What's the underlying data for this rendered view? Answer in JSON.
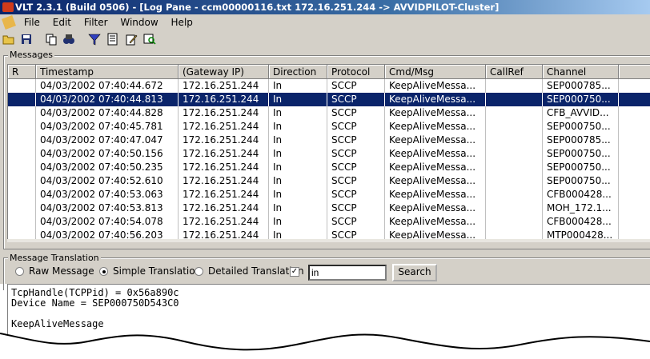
{
  "window": {
    "title": "VLT 2.3.1 (Build 0506) - [Log Pane - ccm00000116.txt   172.16.251.244 -> AVVIDPILOT-Cluster]"
  },
  "menu": {
    "items": [
      "File",
      "Edit",
      "Filter",
      "Window",
      "Help"
    ]
  },
  "toolbar": {
    "icons": [
      "open-icon",
      "save-icon",
      "copy-icon",
      "find-icon",
      "filter-icon",
      "report-icon",
      "edit-icon",
      "search-window-icon"
    ]
  },
  "messages": {
    "group_label": "Messages",
    "columns": [
      "R",
      "Timestamp",
      "(Gateway IP)",
      "Direction",
      "Protocol",
      "Cmd/Msg",
      "CallRef",
      "Channel"
    ],
    "rows": [
      [
        "",
        "04/03/2002 07:40:44.672",
        "172.16.251.244",
        "In",
        "SCCP",
        "KeepAliveMessa...",
        "",
        "SEP000785..."
      ],
      [
        "",
        "04/03/2002 07:40:44.813",
        "172.16.251.244",
        "In",
        "SCCP",
        "KeepAliveMessa...",
        "",
        "SEP000750..."
      ],
      [
        "",
        "04/03/2002 07:40:44.828",
        "172.16.251.244",
        "In",
        "SCCP",
        "KeepAliveMessa...",
        "",
        "CFB_AVVID..."
      ],
      [
        "",
        "04/03/2002 07:40:45.781",
        "172.16.251.244",
        "In",
        "SCCP",
        "KeepAliveMessa...",
        "",
        "SEP000750..."
      ],
      [
        "",
        "04/03/2002 07:40:47.047",
        "172.16.251.244",
        "In",
        "SCCP",
        "KeepAliveMessa...",
        "",
        "SEP000785..."
      ],
      [
        "",
        "04/03/2002 07:40:50.156",
        "172.16.251.244",
        "In",
        "SCCP",
        "KeepAliveMessa...",
        "",
        "SEP000750..."
      ],
      [
        "",
        "04/03/2002 07:40:50.235",
        "172.16.251.244",
        "In",
        "SCCP",
        "KeepAliveMessa...",
        "",
        "SEP000750..."
      ],
      [
        "",
        "04/03/2002 07:40:52.610",
        "172.16.251.244",
        "In",
        "SCCP",
        "KeepAliveMessa...",
        "",
        "SEP000750..."
      ],
      [
        "",
        "04/03/2002 07:40:53.063",
        "172.16.251.244",
        "In",
        "SCCP",
        "KeepAliveMessa...",
        "",
        "CFB000428..."
      ],
      [
        "",
        "04/03/2002 07:40:53.813",
        "172.16.251.244",
        "In",
        "SCCP",
        "KeepAliveMessa...",
        "",
        "MOH_172.1..."
      ],
      [
        "",
        "04/03/2002 07:40:54.078",
        "172.16.251.244",
        "In",
        "SCCP",
        "KeepAliveMessa...",
        "",
        "CFB000428..."
      ],
      [
        "",
        "04/03/2002 07:40:56.203",
        "172.16.251.244",
        "In",
        "SCCP",
        "KeepAliveMessa...",
        "",
        "MTP000428..."
      ]
    ],
    "selected_index": 1
  },
  "translation": {
    "group_label": "Message Translation",
    "options": [
      "Raw Message",
      "Simple Translation",
      "Detailed Translation"
    ],
    "selected_option": "Simple Translation",
    "filter_checked": true,
    "search_value": "in",
    "search_button": "Search",
    "output_lines": [
      "TcpHandle(TCPPid) = 0x56a890c",
      "Device Name = SEP000750D543C0",
      "",
      "KeepAliveMessage"
    ]
  },
  "colors": {
    "title_bar": "#0a246a",
    "selection": "#0a246a",
    "chrome": "#d4d0c8"
  }
}
